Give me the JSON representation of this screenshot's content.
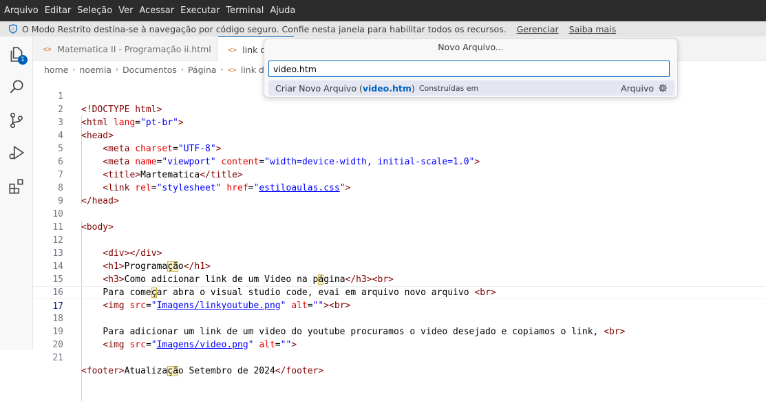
{
  "menu": [
    "Arquivo",
    "Editar",
    "Seleção",
    "Ver",
    "Acessar",
    "Executar",
    "Terminal",
    "Ajuda"
  ],
  "banner": {
    "text": "O Modo Restrito destina-se à navegação por código seguro. Confie nesta janela para habilitar todos os recursos.",
    "manage": "Gerenciar",
    "learn": "Saiba mais"
  },
  "activity": {
    "scm_badge": "1"
  },
  "tabs": [
    {
      "icon": "<>",
      "label": "Matematica II - Programação ii.html"
    },
    {
      "icon": "<>",
      "label": "link do"
    }
  ],
  "breadcrumb": {
    "parts": [
      "home",
      "noemia",
      "Documentos",
      "Página"
    ],
    "file_icon": "<>",
    "file": "link do"
  },
  "quickpick": {
    "title": "Novo Arquivo...",
    "value": "video.htm",
    "item": {
      "prefix": "Criar Novo Arquivo (",
      "name": "video.htm",
      "suffix": ")",
      "desc": "Construídas em",
      "right": "Arquivo"
    }
  },
  "code": {
    "current_line": 17,
    "lines": [
      "1",
      "2",
      "3",
      "4",
      "5",
      "6",
      "7",
      "8",
      "9",
      "10",
      "11",
      "12",
      "13",
      "14",
      "15",
      "16",
      "17",
      "18",
      "19",
      "20",
      "21"
    ],
    "t": {
      "doctype": "<!DOCTYPE html>",
      "html_open": "<html",
      "lang_attr": "lang",
      "lang_val": "\"pt-br\"",
      "head_open": "<head>",
      "meta_open": "<meta",
      "charset_attr": "charset",
      "charset_val": "\"UTF-8\"",
      "name_attr": "name",
      "name_val": "\"viewport\"",
      "content_attr": "content",
      "content_val": "\"width=device-width, initial-scale=1.0\"",
      "title_open": "<title>",
      "title_text": "Martematica",
      "title_close": "</title>",
      "link_open": "<link",
      "rel_attr": "rel",
      "rel_val": "\"stylesheet\"",
      "href_attr": "href",
      "href_val": "estiloaulas.css",
      "head_close": "</head>",
      "body_open": "<body>",
      "div": "<div></div>",
      "h1_open": "<h1>",
      "h1_text_a": "Programa",
      "h1_text_b": "çã",
      "h1_text_c": "o",
      "h1_close": "</h1>",
      "h3_open": "<h3>",
      "h3_text_a": "Como adicionar link de um Video na p",
      "h3_text_b": "á",
      "h3_text_c": "gina",
      "h3_close": "</h3>",
      "br": "<br>",
      "l15_a": "Para come",
      "l15_b": "ç",
      "l15_c": "ar abra o visual studio code, evai em arquivo novo arquivo ",
      "img_open": "<img",
      "src_attr": "src",
      "src1": "Imagens/linkyoutube.png",
      "alt_attr": "alt",
      "alt_val": "\"\"",
      "l18": "Para adicionar um link de um video do youtube procuramos o video desejado e copiamos o link, ",
      "src2": "Imagens/video.png",
      "footer_open": "<footer>",
      "footer_a": "Atualiza",
      "footer_b": "çã",
      "footer_c": "o Setembro de 2024",
      "footer_close": "</footer>"
    }
  }
}
